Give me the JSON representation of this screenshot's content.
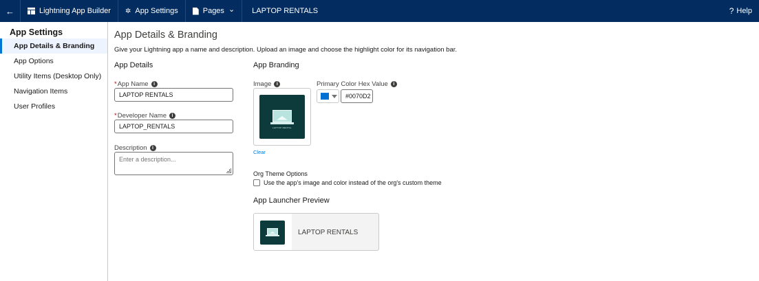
{
  "topbar": {
    "back_icon": "←",
    "app_builder": "Lightning App Builder",
    "app_settings": "App Settings",
    "pages": "Pages",
    "app_name": "LAPTOP RENTALS",
    "help": "Help",
    "help_icon": "?",
    "gear_icon": "✲",
    "chevron_icon": "⌄"
  },
  "sidebar": {
    "title": "App Settings",
    "items": [
      {
        "label": "App Details & Branding"
      },
      {
        "label": "App Options"
      },
      {
        "label": "Utility Items (Desktop Only)"
      },
      {
        "label": "Navigation Items"
      },
      {
        "label": "User Profiles"
      }
    ]
  },
  "main": {
    "title": "App Details & Branding",
    "description": "Give your Lightning app a name and description. Upload an image and choose the highlight color for its navigation bar.",
    "details": {
      "heading": "App Details",
      "app_name_label": "App Name",
      "app_name_value": "LAPTOP RENTALS",
      "developer_name_label": "Developer Name",
      "developer_name_value": "LAPTOP_RENTALS",
      "description_label": "Description",
      "description_placeholder": "Enter a description...",
      "required_mark": "*",
      "info_mark": "i"
    },
    "branding": {
      "heading": "App Branding",
      "image_label": "Image",
      "logo_text": "LAPTOP RENTAL",
      "clear_link": "Clear",
      "primary_color_label": "Primary Color Hex Value",
      "primary_color_value": "#0070D2",
      "primary_color": "#0070d2",
      "org_theme_label": "Org Theme Options",
      "org_theme_checkbox": "Use the app's image and color instead of the org's custom theme",
      "org_theme_checked": false
    },
    "preview": {
      "heading": "App Launcher Preview",
      "app_name": "LAPTOP RENTALS"
    }
  }
}
